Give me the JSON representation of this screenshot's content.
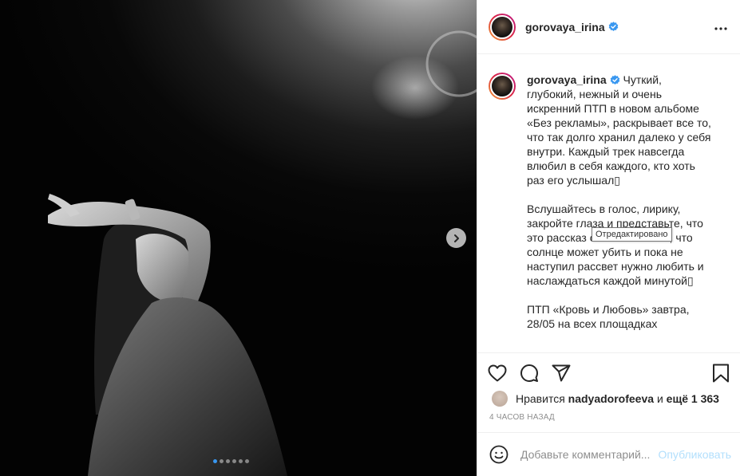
{
  "post": {
    "username": "gorovaya_irina",
    "verified": true,
    "more_icon": "more-horizontal-icon"
  },
  "caption": {
    "username": "gorovaya_irina",
    "text": "Чуткий, глубокий, нежный и очень искренний ПТП в новом альбоме «Без рекламы», раскрывает все то, что так долго хранил далеко у себя внутри. Каждый трек навсегда влюбил в себя каждого, кто хоть раз его услышал▯\n\nВслушайтесь в голос, лирику, закройте глаза и представьте, что это рассказ о любви. О том, что солнце может убить и пока не наступил рассвет нужно любить и наслаждаться каждой минутой▯\n\nПТП «Кровь и Любовь» завтра, 28/05 на всех площадках",
    "tooltip": "Отредактировано"
  },
  "actions": {
    "like_icon": "heart-icon",
    "comment_icon": "comment-icon",
    "share_icon": "send-icon",
    "save_icon": "bookmark-icon"
  },
  "likes": {
    "prefix": "Нравится",
    "user": "nadyadorofeeva",
    "and": "и",
    "count": "ещё 1 363"
  },
  "timestamp": "4 часов назад",
  "comment": {
    "placeholder": "Добавьте комментарий...",
    "post_label": "Опубликовать",
    "emoji_icon": "smile-icon"
  },
  "carousel": {
    "total_slides": 6,
    "active_slide": 1
  },
  "colors": {
    "accent": "#3897f0",
    "verified": "#3897f0",
    "post_button_disabled": "#b2dffc",
    "muted_text": "#8e8e8e"
  }
}
